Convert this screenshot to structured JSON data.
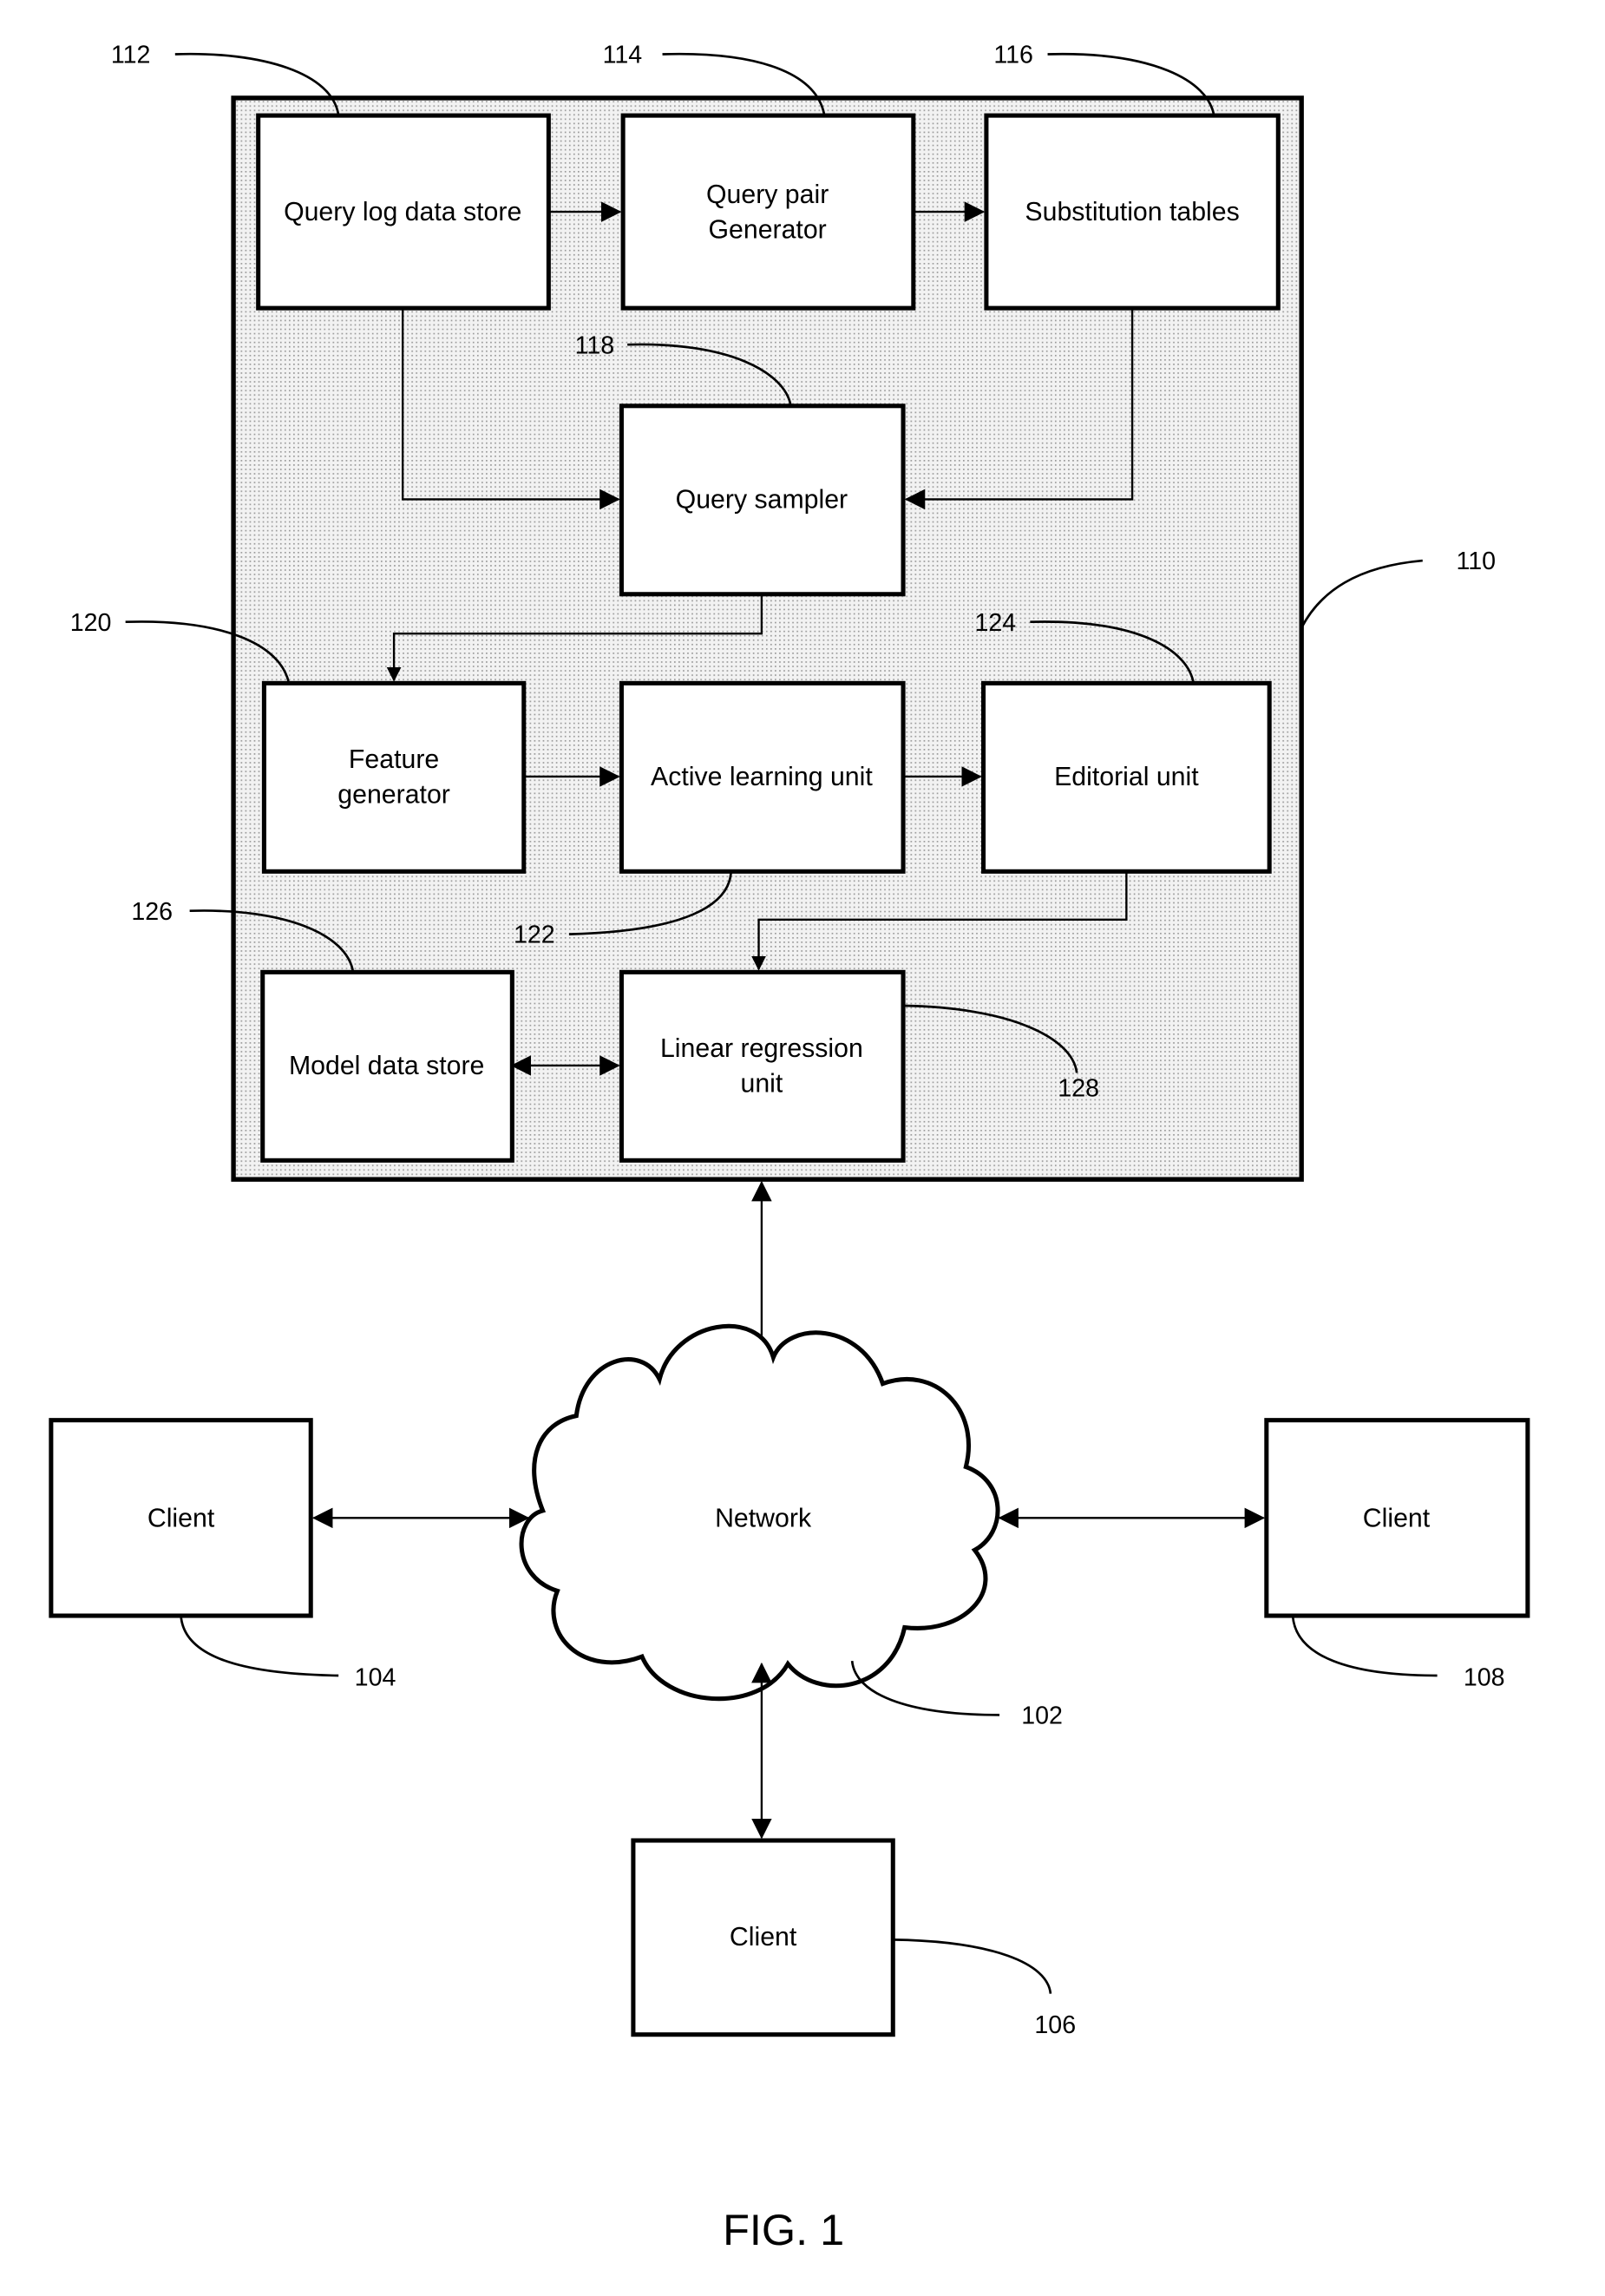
{
  "figure": {
    "caption": "FIG. 1",
    "system": {
      "ref": "110"
    },
    "components": {
      "query_log": {
        "label": [
          "Query log data store"
        ],
        "ref": "112"
      },
      "query_pair": {
        "label": [
          "Query pair",
          "Generator"
        ],
        "ref": "114"
      },
      "substitution": {
        "label": [
          "Substitution tables"
        ],
        "ref": "116"
      },
      "query_sampler": {
        "label": [
          "Query sampler"
        ],
        "ref": "118"
      },
      "feature_gen": {
        "label": [
          "Feature",
          "generator"
        ],
        "ref": "120"
      },
      "active_learning": {
        "label": [
          "Active learning unit"
        ],
        "ref": "122"
      },
      "editorial": {
        "label": [
          "Editorial unit"
        ],
        "ref": "124"
      },
      "model_store": {
        "label": [
          "Model data store"
        ],
        "ref": "126"
      },
      "linear_regression": {
        "label": [
          "Linear regression",
          "unit"
        ],
        "ref": "128"
      }
    },
    "network": {
      "label": "Network",
      "ref": "102"
    },
    "clients": [
      {
        "label": "Client",
        "ref": "104"
      },
      {
        "label": "Client",
        "ref": "106"
      },
      {
        "label": "Client",
        "ref": "108"
      }
    ]
  }
}
